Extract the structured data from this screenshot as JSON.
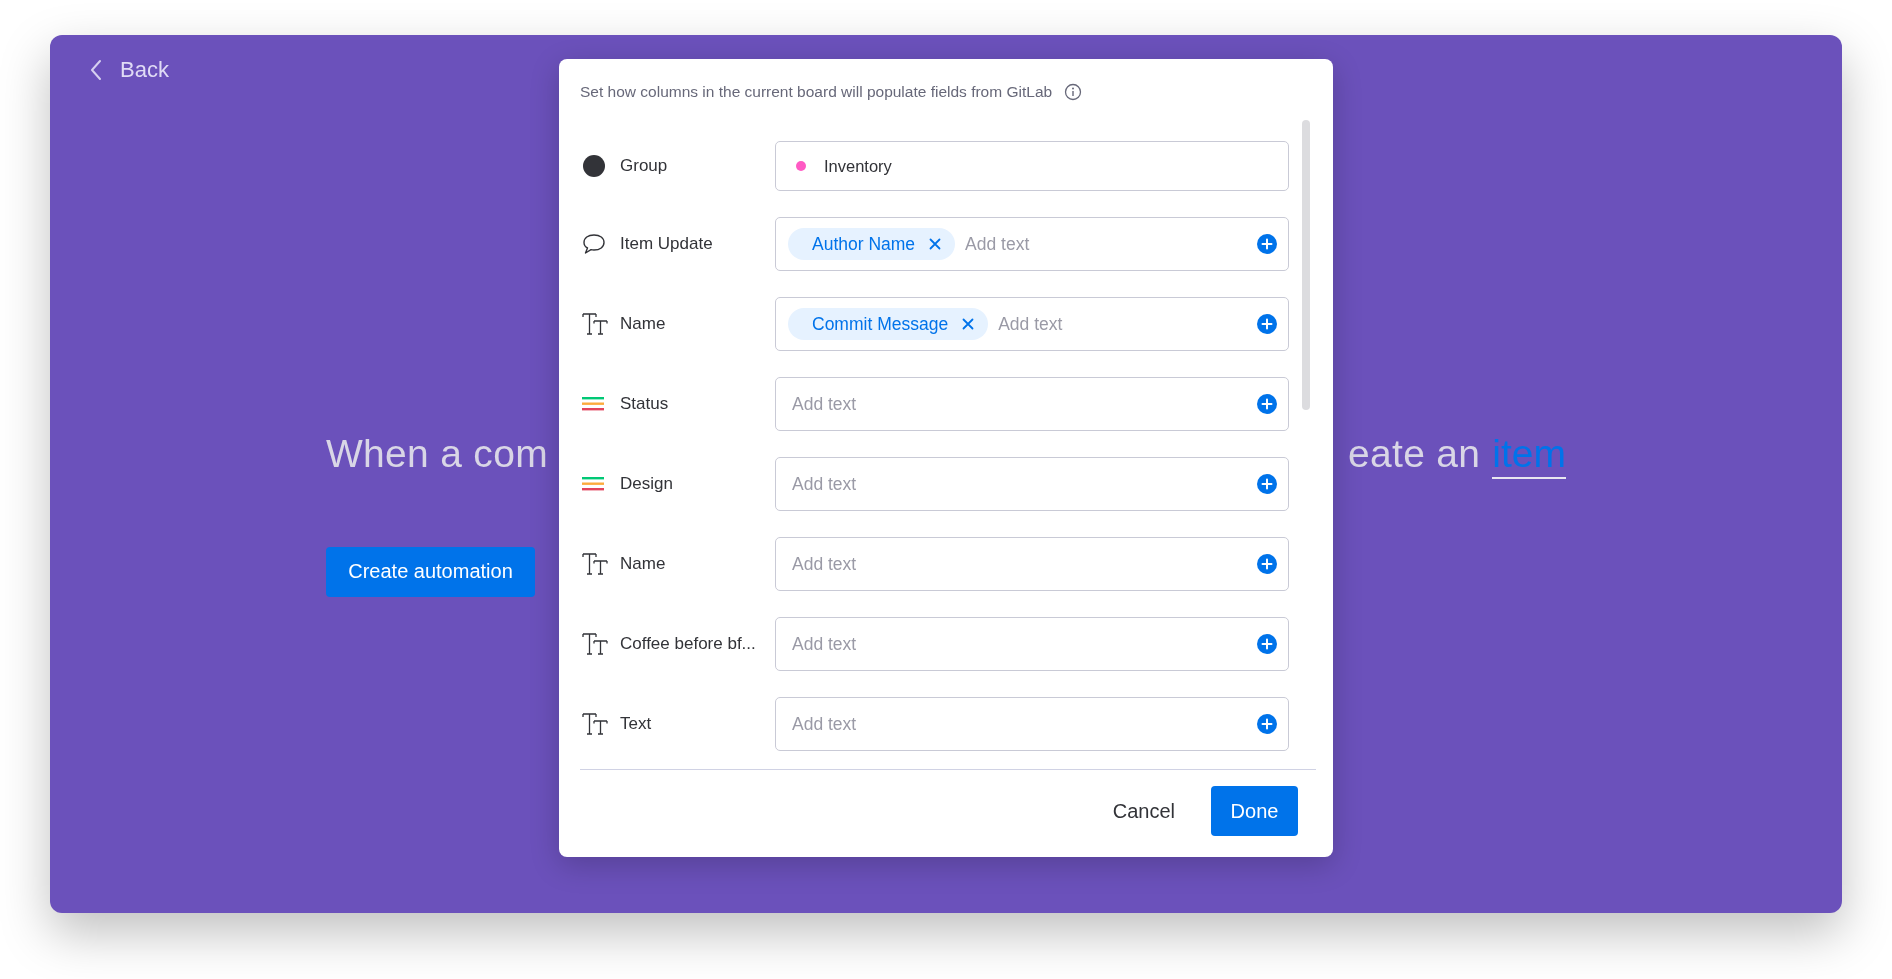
{
  "back": {
    "label": "Back"
  },
  "headline": {
    "left": "When a com",
    "right": "eate an",
    "link": "item"
  },
  "create_button": {
    "label": "Create automation"
  },
  "modal": {
    "description": "Set how columns in the current board will populate fields from GitLab",
    "rows": [
      {
        "kind": "group",
        "label": "Group",
        "value": "Inventory",
        "color": "#ff5ac4"
      },
      {
        "kind": "update",
        "label": "Item Update",
        "tokens": [
          "Author Name"
        ],
        "placeholder": "Add text"
      },
      {
        "kind": "text",
        "label": "Name",
        "tokens": [
          "Commit Message"
        ],
        "placeholder": "Add text"
      },
      {
        "kind": "status",
        "label": "Status",
        "tokens": [],
        "placeholder": "Add text"
      },
      {
        "kind": "status",
        "label": "Design",
        "tokens": [],
        "placeholder": "Add text"
      },
      {
        "kind": "text",
        "label": "Name",
        "tokens": [],
        "placeholder": "Add text"
      },
      {
        "kind": "text",
        "label": "Coffee before bf...",
        "tokens": [],
        "placeholder": "Add text"
      },
      {
        "kind": "text",
        "label": "Text",
        "tokens": [],
        "placeholder": "Add text"
      }
    ],
    "buttons": [
      {
        "kind": "secondary",
        "label": "Cancel"
      },
      {
        "kind": "primary",
        "label": "Done"
      }
    ]
  }
}
